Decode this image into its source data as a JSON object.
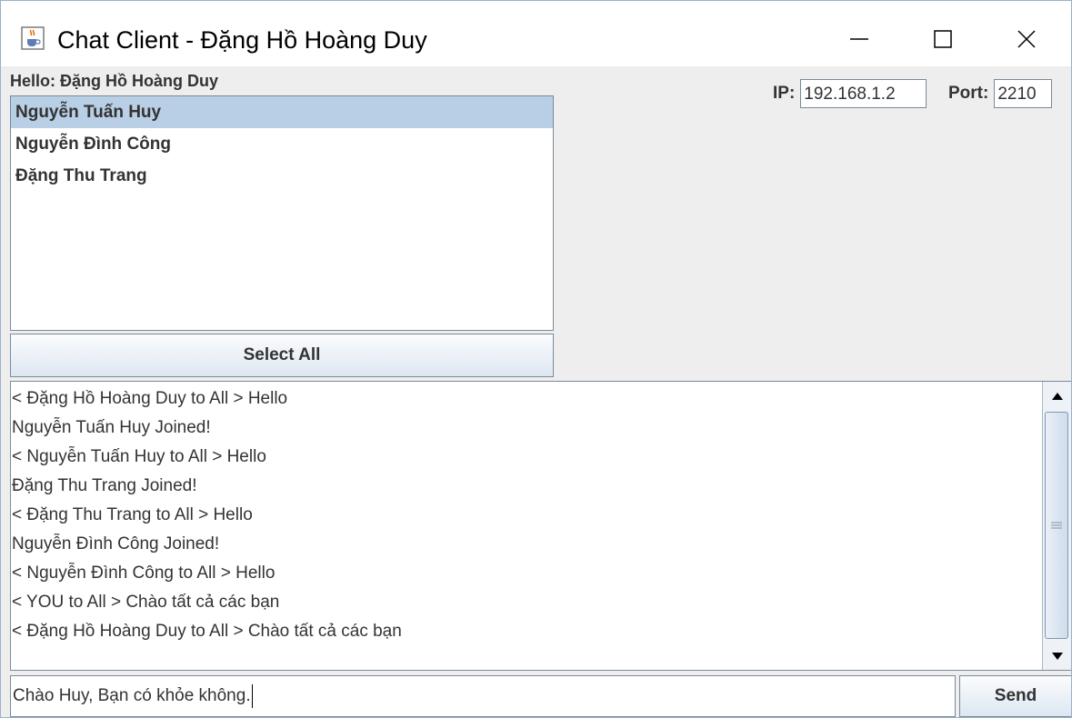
{
  "window": {
    "title": "Chat Client - Đặng Hồ Hoàng Duy",
    "icon": "java-cup-icon"
  },
  "header": {
    "greeting": "Hello: Đặng Hồ Hoàng Duy"
  },
  "users": [
    {
      "name": "Nguyễn Tuấn Huy",
      "selected": true
    },
    {
      "name": "Nguyễn Đình Công",
      "selected": false
    },
    {
      "name": "Đặng Thu Trang",
      "selected": false
    }
  ],
  "select_all_label": "Select All",
  "connection": {
    "ip_label": "IP:",
    "ip_value": "192.168.1.2",
    "port_label": "Port:",
    "port_value": "2210"
  },
  "chat_log": [
    "< Đặng Hồ Hoàng Duy to All > Hello",
    "Nguyễn Tuấn Huy Joined!",
    "< Nguyễn Tuấn Huy to All > Hello",
    "Đặng Thu Trang Joined!",
    "< Đặng Thu Trang to All > Hello",
    "Nguyễn Đình Công Joined!",
    "< Nguyễn Đình Công to All > Hello",
    "< YOU to All > Chào tất cả các bạn",
    "< Đặng Hồ Hoàng Duy to All > Chào tất cả các bạn"
  ],
  "message_input": {
    "value": "Chào Huy, Bạn có khỏe không."
  },
  "send_label": "Send",
  "colors": {
    "selection": "#b8cfe5",
    "panel_bg": "#eeeeee",
    "border": "#7a8a99"
  }
}
